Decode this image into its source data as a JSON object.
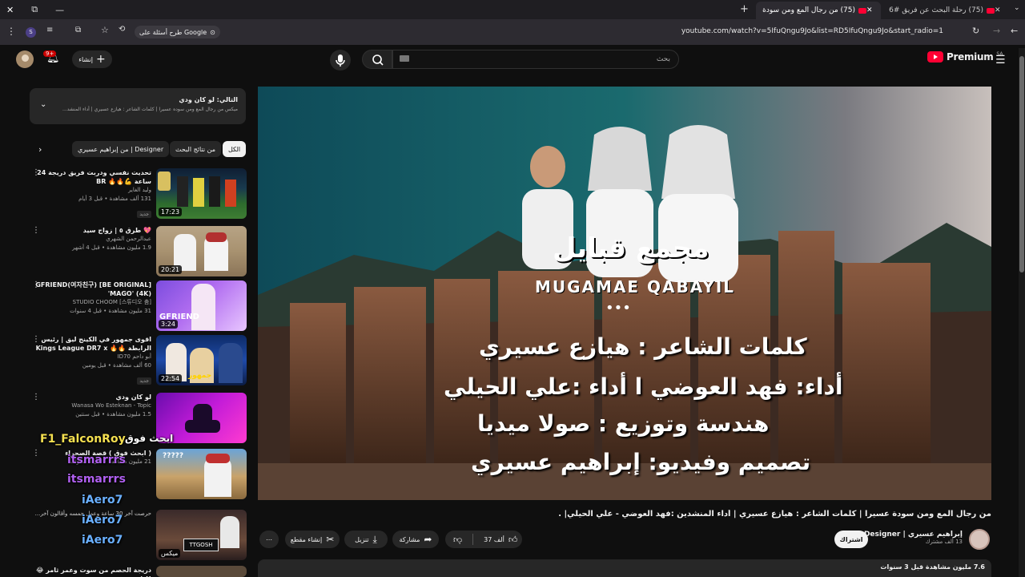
{
  "browser": {
    "tabs": [
      {
        "title": "(75) رحلة البحث عن فريق #6 | ال"
      },
      {
        "title": "(75) من رجال المع ومن سودة عسـ"
      }
    ],
    "url": "youtube.com/watch?v=5IfuQngu9Jo&list=RD5IfuQngu9Jo&start_radio=1",
    "google_chip": "طرح أسئلة على Google"
  },
  "youtube": {
    "logo_text": "Premium",
    "region": "SA",
    "search_placeholder": "بحث",
    "create_label": "إنشاء",
    "notif_count": "9+"
  },
  "up_next": {
    "title": "التالي: لو كان ودي",
    "subtitle": "ميكس من رجال المع ومن سوده عسيرا | كلمات الشاعر : هيازع عسيري | أداء المنشد..."
  },
  "chips": [
    {
      "label": "الكل"
    },
    {
      "label": "من نتائج البحث"
    },
    {
      "label": "من إبراهيم عسيري | Designer"
    }
  ],
  "videos": [
    {
      "title": "تحديت نفسي ودربت فريق دريجة 24 ساعة 💪🔥🔥 BR",
      "channel": "وليد الغاير",
      "meta": "131 ألف مشاهدة • قبل 3 أيام",
      "badge": "جديد",
      "duration": "17:23"
    },
    {
      "title": "💖 طرق ٥ | زواج سيد",
      "channel": "عبدالرحمن الشهري",
      "meta": "1.9 مليون مشاهدة • قبل 4 أشهر",
      "badge": "",
      "duration": "20:21"
    },
    {
      "title": "[BE ORIGINAL] GFRIEND(여자친구) 'MAGO' (4K)",
      "channel": "STUDIO CHOOM [스튜디오 춤]",
      "meta": "31 مليون مشاهدة • قبل 4 سنوات",
      "badge": "",
      "duration": "3:24"
    },
    {
      "title": "اقوى جمهور في الكينج ليق | رئيس الرابطة 🔥🔥 Kings League DR7 x ...",
      "channel": "أبو داحم ID70",
      "meta": "60 ألف مشاهدة • قبل يومين",
      "badge": "جديد",
      "duration": "22:54"
    },
    {
      "title": "لو كان ودي",
      "channel": "Wanasa Wo Esteknan - Topic",
      "meta": "1.5 مليون مشاهدة • قبل سنتين",
      "badge": "",
      "duration": ""
    },
    {
      "title": "( ابحث فوق ) قصة الصحراء",
      "channel": "",
      "meta": "21 مليون مشاهدة • قبل 3 سنوات",
      "badge": "",
      "duration": ""
    },
    {
      "title": "حرصت آخر 30 ساعة وعمل حمسه وأقالون آخر...",
      "channel": "",
      "meta": "",
      "badge": "",
      "duration": "ميكس"
    },
    {
      "title": "دريجة الحصم من سوت وعمر ثامر 😂 !! (",
      "channel": "",
      "meta": "",
      "badge": "",
      "duration": ""
    }
  ],
  "chat_overlay": [
    "F1_FalconRoy",
    "ابحث فوق",
    "itsmarrrs",
    "itsmarrrs",
    "iAero7",
    "iAero7",
    "iAero7"
  ],
  "player": {
    "brand_ar": "مجمع قبايل",
    "brand_en": "MUGAMAE QABAYIL",
    "line1": "كلمات الشاعر : هيازع عسيري",
    "line2": "أداء: فهد العوضي ا أداء :علي الحيلي",
    "line3": "هندسة وتوزيع : صولا ميديا",
    "line4": "تصميم وفيديو: إبراهيم عسيري"
  },
  "video": {
    "title": "من رجال المع ومن سودة عسيرا | كلمات الشاعر : هيازع عسيري | أداء المنشدين :فهد العوضي - علي الحيلي| .",
    "channel": "إبراهيم عسيري | Designer",
    "subscribers": "13 ألف مشترك",
    "subscribe_label": "اشتراك",
    "likes": "37 ألف",
    "share_label": "مشاركة",
    "download_label": "تنزيل",
    "clip_label": "إنشاء مقطع",
    "desc_meta": "7.6 مليون مشاهدة قبل 3 سنوات"
  }
}
